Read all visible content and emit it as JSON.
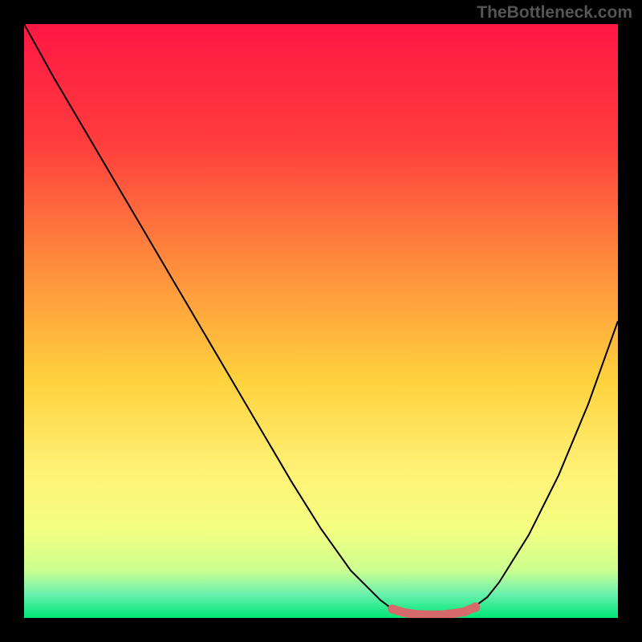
{
  "watermark": "TheBottleneck.com",
  "chart_data": {
    "type": "line",
    "title": "",
    "xlabel": "",
    "ylabel": "",
    "xlim": [
      0,
      100
    ],
    "ylim": [
      0,
      100
    ],
    "x": [
      0,
      5,
      10,
      15,
      20,
      25,
      30,
      35,
      40,
      45,
      50,
      55,
      60,
      62,
      64,
      66,
      68,
      70,
      72,
      74,
      76,
      78,
      80,
      85,
      90,
      95,
      100
    ],
    "y": [
      100,
      91,
      82.5,
      74,
      65.5,
      57,
      48.5,
      40,
      31.5,
      23,
      15,
      8,
      3,
      1.5,
      0.8,
      0.5,
      0.5,
      0.5,
      0.6,
      1,
      2,
      3.5,
      6,
      14,
      24,
      36,
      50
    ],
    "markers": {
      "x": [
        62,
        64,
        66,
        68,
        70,
        72,
        74,
        76
      ],
      "y": [
        1.5,
        0.9,
        0.6,
        0.5,
        0.5,
        0.7,
        1.0,
        1.8
      ],
      "color": "#d66a6a"
    },
    "gradient": {
      "stops": [
        {
          "offset": 0,
          "color": "#ff1744"
        },
        {
          "offset": 20,
          "color": "#ff3d3d"
        },
        {
          "offset": 40,
          "color": "#ff8a3d"
        },
        {
          "offset": 60,
          "color": "#ffd23d"
        },
        {
          "offset": 75,
          "color": "#fff176"
        },
        {
          "offset": 85,
          "color": "#f4ff81"
        },
        {
          "offset": 92,
          "color": "#ccff90"
        },
        {
          "offset": 96,
          "color": "#69f0ae"
        },
        {
          "offset": 100,
          "color": "#00e676"
        }
      ]
    }
  }
}
